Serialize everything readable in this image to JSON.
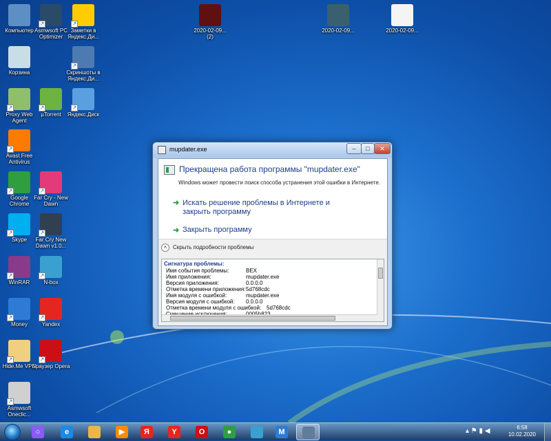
{
  "desktop": {
    "icons": [
      {
        "label": "Компьютер",
        "icon": "computer-icon",
        "color": "#5d8fc5"
      },
      {
        "label": "Asmwsoft PC Optimizer",
        "icon": "tools-icon",
        "color": "#2a4a6a"
      },
      {
        "label": "Заметки в Яндекс.Ди...",
        "icon": "yandex-notes-icon",
        "color": "#ffcc00"
      },
      {
        "label": "Корзина",
        "icon": "recycle-bin-icon",
        "color": "#c9dde8"
      },
      {
        "label": "Скриншоты в Яндекс.Ди...",
        "icon": "screenshots-icon",
        "color": "#4d7ab0"
      },
      {
        "label": "Proxy Web Agent",
        "icon": "proxy-agent-icon",
        "color": "#8fbf6a"
      },
      {
        "label": "µTorrent",
        "icon": "utorrent-icon",
        "color": "#6cb33f"
      },
      {
        "label": "Яндекс.Диск",
        "icon": "yandex-disk-icon",
        "color": "#5aa0e0"
      },
      {
        "label": "Avast Free Antivirus",
        "icon": "avast-icon",
        "color": "#ff7a00"
      },
      {
        "label": "Google Chrome",
        "icon": "chrome-icon",
        "color": "#2e9e3e"
      },
      {
        "label": "Far Cry - New Dawn",
        "icon": "farcry-icon",
        "color": "#e43a7a"
      },
      {
        "label": "Skype",
        "icon": "skype-icon",
        "color": "#00aff0"
      },
      {
        "label": "Far Cry New Dawn v1.0...",
        "icon": "farcry-trainer-icon",
        "color": "#304050"
      },
      {
        "label": "WinRAR",
        "icon": "winrar-icon",
        "color": "#8a3a8a"
      },
      {
        "label": "N-box",
        "icon": "nbox-icon",
        "color": "#3aa0d0"
      },
      {
        "label": "Money",
        "icon": "money-icon",
        "color": "#2d7bd4"
      },
      {
        "label": "Yandex",
        "icon": "yandex-browser-icon",
        "color": "#e52620"
      },
      {
        "label": "Hide.Me VPN",
        "icon": "vpn-icon",
        "color": "#f0d080"
      },
      {
        "label": "Браузер Opera",
        "icon": "opera-icon",
        "color": "#cc0f16"
      },
      {
        "label": "Asmwsoft Oneclic...",
        "icon": "oneclick-icon",
        "color": "#d0d0d0"
      },
      {
        "label": "2020-02-09...\n(2)",
        "icon": "screenshot-file-icon",
        "color": "#601010"
      },
      {
        "label": "2020-02-09...",
        "icon": "screenshot-file-icon",
        "color": "#3a6070"
      },
      {
        "label": "2020-02-09...",
        "icon": "document-file-icon",
        "color": "#f4f4f4"
      }
    ]
  },
  "dialog": {
    "title": "mupdater.exe",
    "heading": "Прекращена работа программы \"mupdater.exe\"",
    "subtext": "Windows может провести поиск способа устранения этой ошибки в Интернете.",
    "option1": "Искать решение проблемы в Интернете и закрыть программу",
    "option2": "Закрыть программу",
    "details_toggle": "Скрыть подробности проблемы",
    "signature_title": "Сигнатура проблемы:",
    "details": [
      {
        "k": "Имя события проблемы:",
        "v": "BEX"
      },
      {
        "k": "Имя приложения:",
        "v": "mupdater.exe"
      },
      {
        "k": "Версия приложения:",
        "v": "0.0.0.0"
      },
      {
        "k": "Отметка времени приложения:",
        "v": "5d768cdc"
      },
      {
        "k": "Имя модуля с ошибкой:",
        "v": "mupdater.exe"
      },
      {
        "k": "Версия модуля с ошибкой:",
        "v": "0.0.0.0"
      },
      {
        "k": "Отметка времени модуля с ошибкой:",
        "v": "5d768cdc"
      },
      {
        "k": "Смещение исключения:",
        "v": "0005b823"
      }
    ],
    "caption_close": "✕",
    "caption_min": "–",
    "caption_max": "□"
  },
  "taskbar": {
    "buttons": [
      {
        "icon": "alice-icon",
        "color": "#8a5cf6",
        "glyph": "○"
      },
      {
        "icon": "internet-explorer-icon",
        "color": "#1e88e5",
        "glyph": "e"
      },
      {
        "icon": "explorer-folder-icon",
        "color": "#e8b84a",
        "glyph": ""
      },
      {
        "icon": "media-player-icon",
        "color": "#ff8a00",
        "glyph": "▶"
      },
      {
        "icon": "yandex-notes-icon",
        "color": "#e52620",
        "glyph": "Я"
      },
      {
        "icon": "yandex-browser-icon",
        "color": "#e52620",
        "glyph": "Y"
      },
      {
        "icon": "opera-icon",
        "color": "#cc0f16",
        "glyph": "O"
      },
      {
        "icon": "chrome-icon",
        "color": "#2e9e3e",
        "glyph": "●"
      },
      {
        "icon": "nbox-icon",
        "color": "#3aa0d0",
        "glyph": ""
      },
      {
        "icon": "money-icon",
        "color": "#2d7bd4",
        "glyph": "M"
      },
      {
        "icon": "mupdater-icon",
        "color": "#607d9b",
        "glyph": ""
      }
    ],
    "active_index": 10,
    "tray": "▴  ⚑  ▮  ◀",
    "time": "6:58",
    "date": "10.02.2020"
  }
}
